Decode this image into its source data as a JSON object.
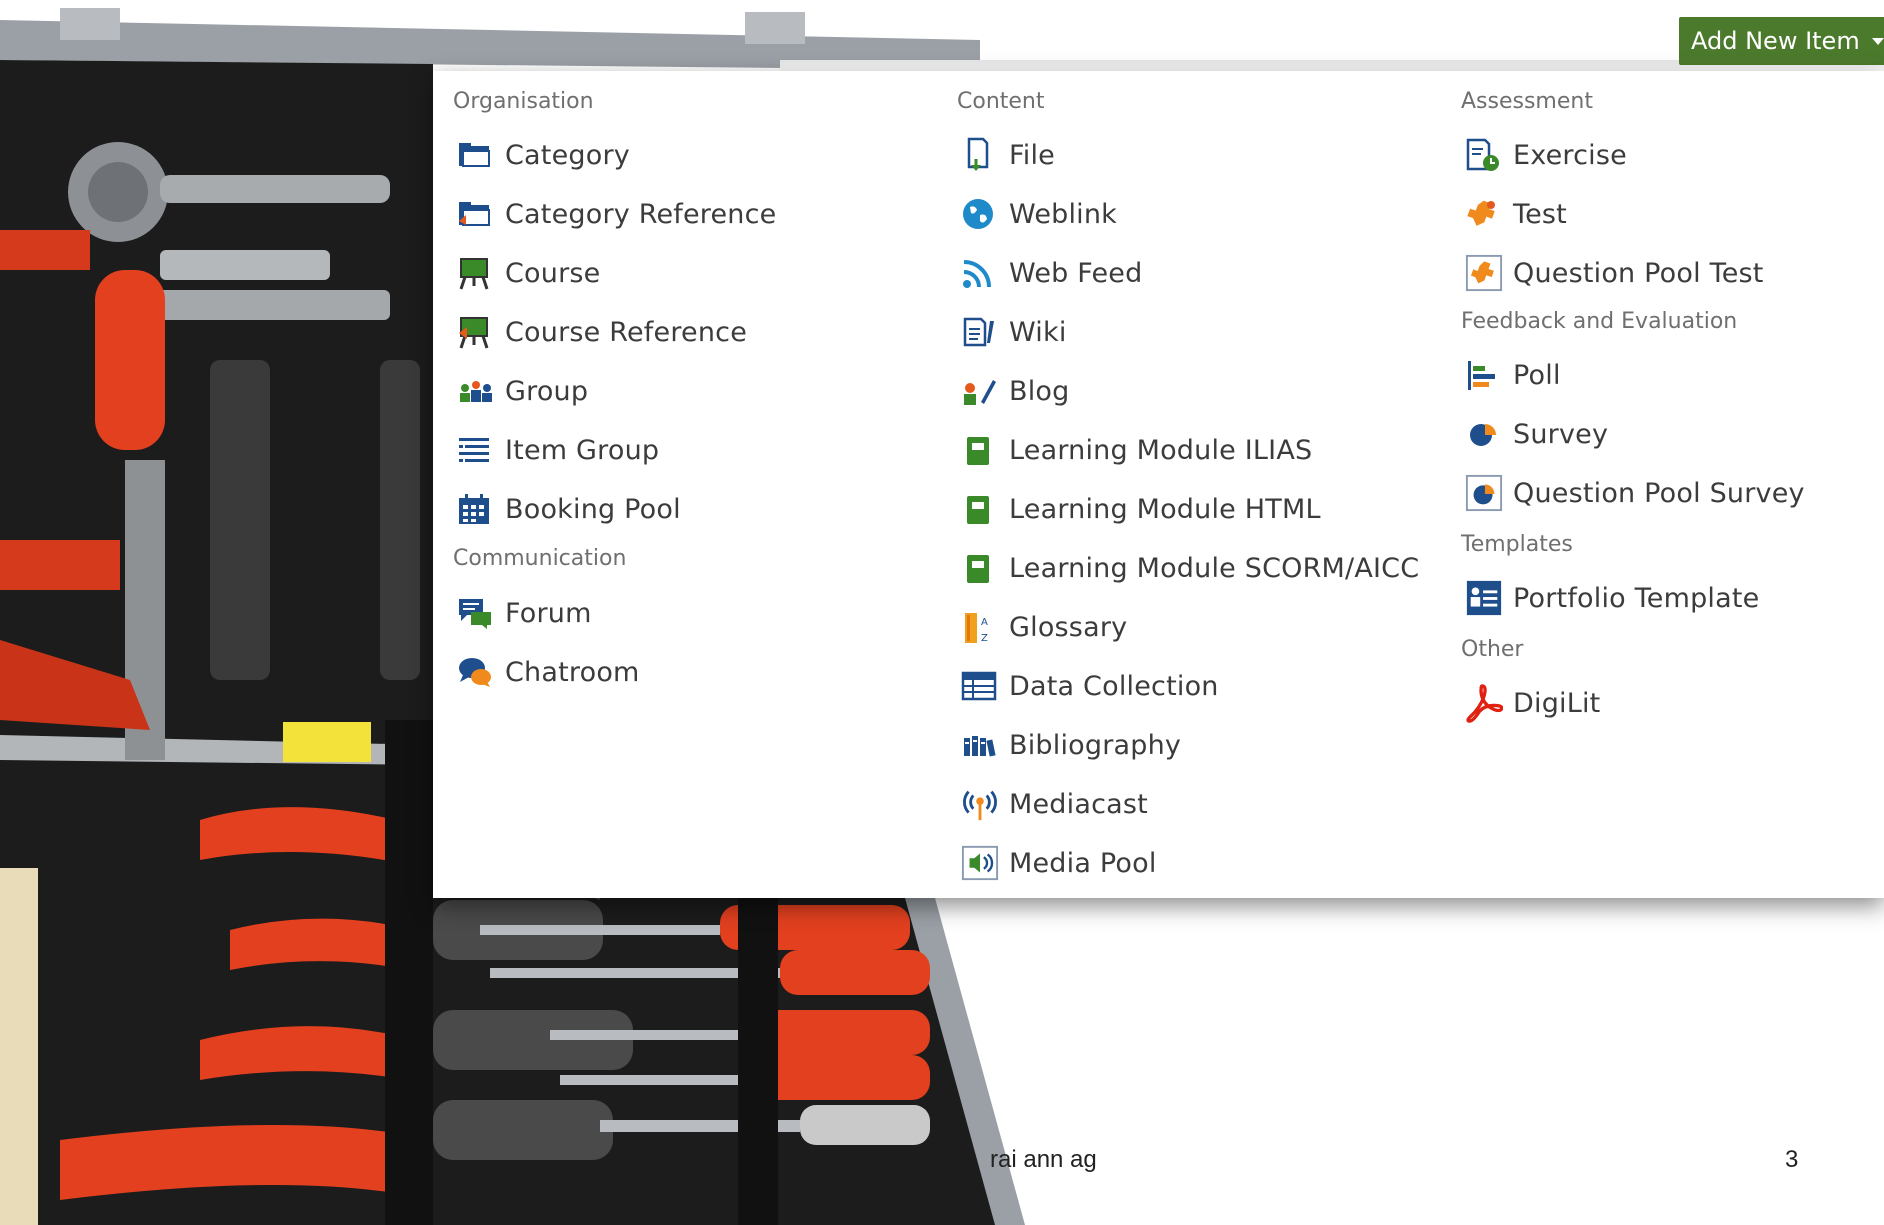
{
  "button": {
    "label": "Add New Item"
  },
  "columns": [
    {
      "sections": [
        {
          "title": "Organisation",
          "items": [
            {
              "label": "Category",
              "icon": "category-icon"
            },
            {
              "label": "Category Reference",
              "icon": "category-reference-icon"
            },
            {
              "label": "Course",
              "icon": "course-icon"
            },
            {
              "label": "Course Reference",
              "icon": "course-reference-icon"
            },
            {
              "label": "Group",
              "icon": "group-icon"
            },
            {
              "label": "Item Group",
              "icon": "item-group-icon"
            },
            {
              "label": "Booking Pool",
              "icon": "booking-pool-icon"
            }
          ]
        },
        {
          "title": "Communication",
          "items": [
            {
              "label": "Forum",
              "icon": "forum-icon"
            },
            {
              "label": "Chatroom",
              "icon": "chatroom-icon"
            }
          ]
        }
      ]
    },
    {
      "sections": [
        {
          "title": "Content",
          "items": [
            {
              "label": "File",
              "icon": "file-icon"
            },
            {
              "label": "Weblink",
              "icon": "weblink-icon"
            },
            {
              "label": "Web Feed",
              "icon": "web-feed-icon"
            },
            {
              "label": "Wiki",
              "icon": "wiki-icon"
            },
            {
              "label": "Blog",
              "icon": "blog-icon"
            },
            {
              "label": "Learning Module ILIAS",
              "icon": "learning-module-icon"
            },
            {
              "label": "Learning Module HTML",
              "icon": "learning-module-icon"
            },
            {
              "label": "Learning Module SCORM/AICC",
              "icon": "learning-module-icon"
            },
            {
              "label": "Glossary",
              "icon": "glossary-icon"
            },
            {
              "label": "Data Collection",
              "icon": "data-collection-icon"
            },
            {
              "label": "Bibliography",
              "icon": "bibliography-icon"
            },
            {
              "label": "Mediacast",
              "icon": "mediacast-icon"
            },
            {
              "label": "Media Pool",
              "icon": "media-pool-icon"
            }
          ]
        }
      ]
    },
    {
      "sections": [
        {
          "title": "Assessment",
          "items": [
            {
              "label": "Exercise",
              "icon": "exercise-icon"
            },
            {
              "label": "Test",
              "icon": "test-icon"
            },
            {
              "label": "Question Pool Test",
              "icon": "question-pool-test-icon"
            }
          ]
        },
        {
          "title": "Feedback and Evaluation",
          "items": [
            {
              "label": "Poll",
              "icon": "poll-icon"
            },
            {
              "label": "Survey",
              "icon": "survey-icon"
            },
            {
              "label": "Question Pool Survey",
              "icon": "question-pool-survey-icon"
            }
          ]
        },
        {
          "title": "Templates",
          "items": [
            {
              "label": "Portfolio Template",
              "icon": "portfolio-template-icon"
            }
          ]
        },
        {
          "title": "Other",
          "items": [
            {
              "label": "DigiLit",
              "icon": "digilit-icon"
            }
          ]
        }
      ]
    }
  ],
  "footer": {
    "text": "rai ann ag",
    "page_number": "3"
  }
}
